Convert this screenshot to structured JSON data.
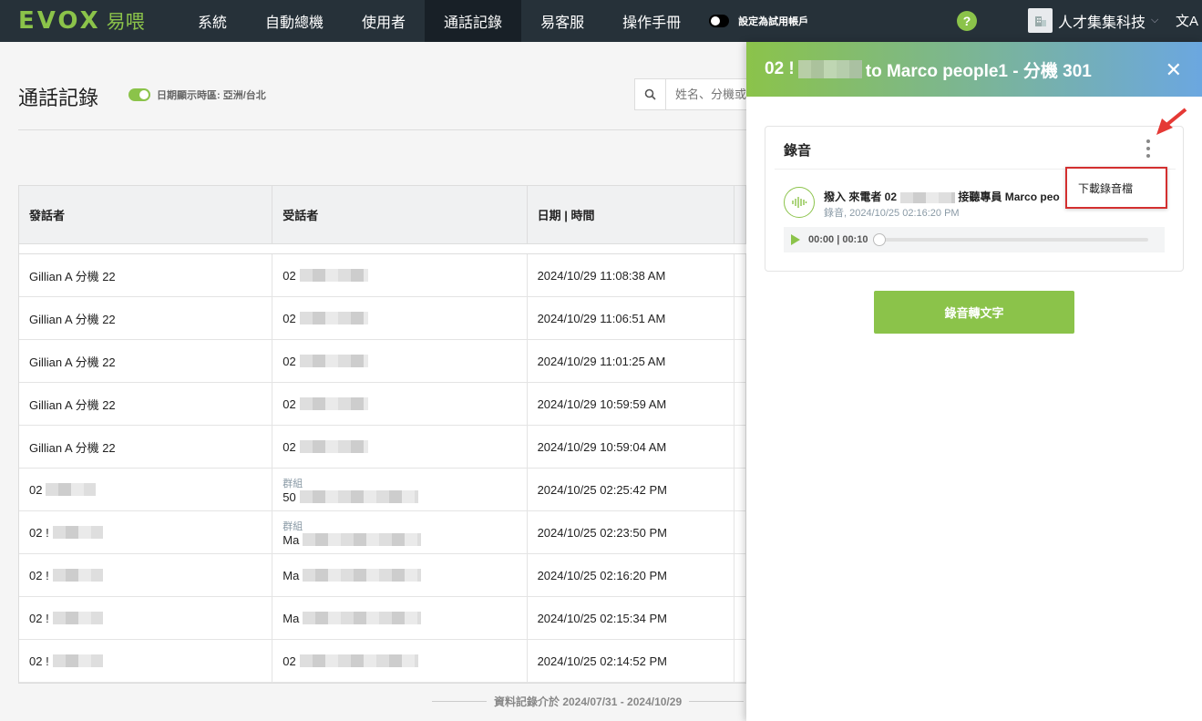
{
  "brand": {
    "name": "EVOX",
    "name_cn": "易喂"
  },
  "nav": {
    "items": [
      "系統",
      "自動總機",
      "使用者",
      "通話記錄",
      "易客服",
      "操作手冊"
    ],
    "active_index": 3,
    "trial_label": "設定為試用帳戶",
    "help": "?",
    "company": "人才集集科技",
    "lang_icon": "文A"
  },
  "page": {
    "title": "通話記錄",
    "timezone_label": "日期顯示時區: 亞洲/台北",
    "search_placeholder": "姓名、分機或",
    "footer_note": "資料記錄介於 2024/07/31 - 2024/10/29"
  },
  "table": {
    "headers": [
      "發話者",
      "受話者",
      "日期 | 時間"
    ],
    "rows": [
      {
        "caller": "Gillian A 分機 22",
        "callee_prefix": "02",
        "callee_sub": "",
        "datetime": "2024/10/29 11:08:38 AM"
      },
      {
        "caller": "Gillian A 分機 22",
        "callee_prefix": "02",
        "callee_sub": "",
        "datetime": "2024/10/29 11:06:51 AM"
      },
      {
        "caller": "Gillian A 分機 22",
        "callee_prefix": "02",
        "callee_sub": "",
        "datetime": "2024/10/29 11:01:25 AM"
      },
      {
        "caller": "Gillian A 分機 22",
        "callee_prefix": "02",
        "callee_sub": "",
        "datetime": "2024/10/29 10:59:59 AM"
      },
      {
        "caller": "Gillian A 分機 22",
        "callee_prefix": "02",
        "callee_sub": "",
        "datetime": "2024/10/29 10:59:04 AM"
      },
      {
        "caller": "02",
        "callee_prefix": "50",
        "callee_sub": "群組",
        "datetime": "2024/10/25 02:25:42 PM"
      },
      {
        "caller": "02 !",
        "callee_prefix": "Ma",
        "callee_sub": "群組",
        "datetime": "2024/10/25 02:23:50 PM"
      },
      {
        "caller": "02 !",
        "callee_prefix": "Ma",
        "callee_sub": "",
        "datetime": "2024/10/25 02:16:20 PM"
      },
      {
        "caller": "02 !",
        "callee_prefix": "Ma",
        "callee_sub": "",
        "datetime": "2024/10/25 02:15:34 PM"
      },
      {
        "caller": "02 !",
        "callee_prefix": "02",
        "callee_sub": "",
        "datetime": "2024/10/25 02:14:52 PM"
      }
    ]
  },
  "panel": {
    "title_prefix": "02 !",
    "title_suffix": "to Marco people1 - 分機 301",
    "close_icon": "✕",
    "card_title": "錄音",
    "recording_line_a": "撥入 來電者 02",
    "recording_line_b": "接聽專員 Marco peo",
    "recording_sub": "錄音, 2024/10/25 02:16:20 PM",
    "player_time": "00:00 | 00:10",
    "dropdown_item": "下載錄音檔",
    "stt_button": "錄音轉文字"
  },
  "colors": {
    "accent": "#8bc34a",
    "topbar": "#263139",
    "highlight_border": "#d32f2f"
  }
}
